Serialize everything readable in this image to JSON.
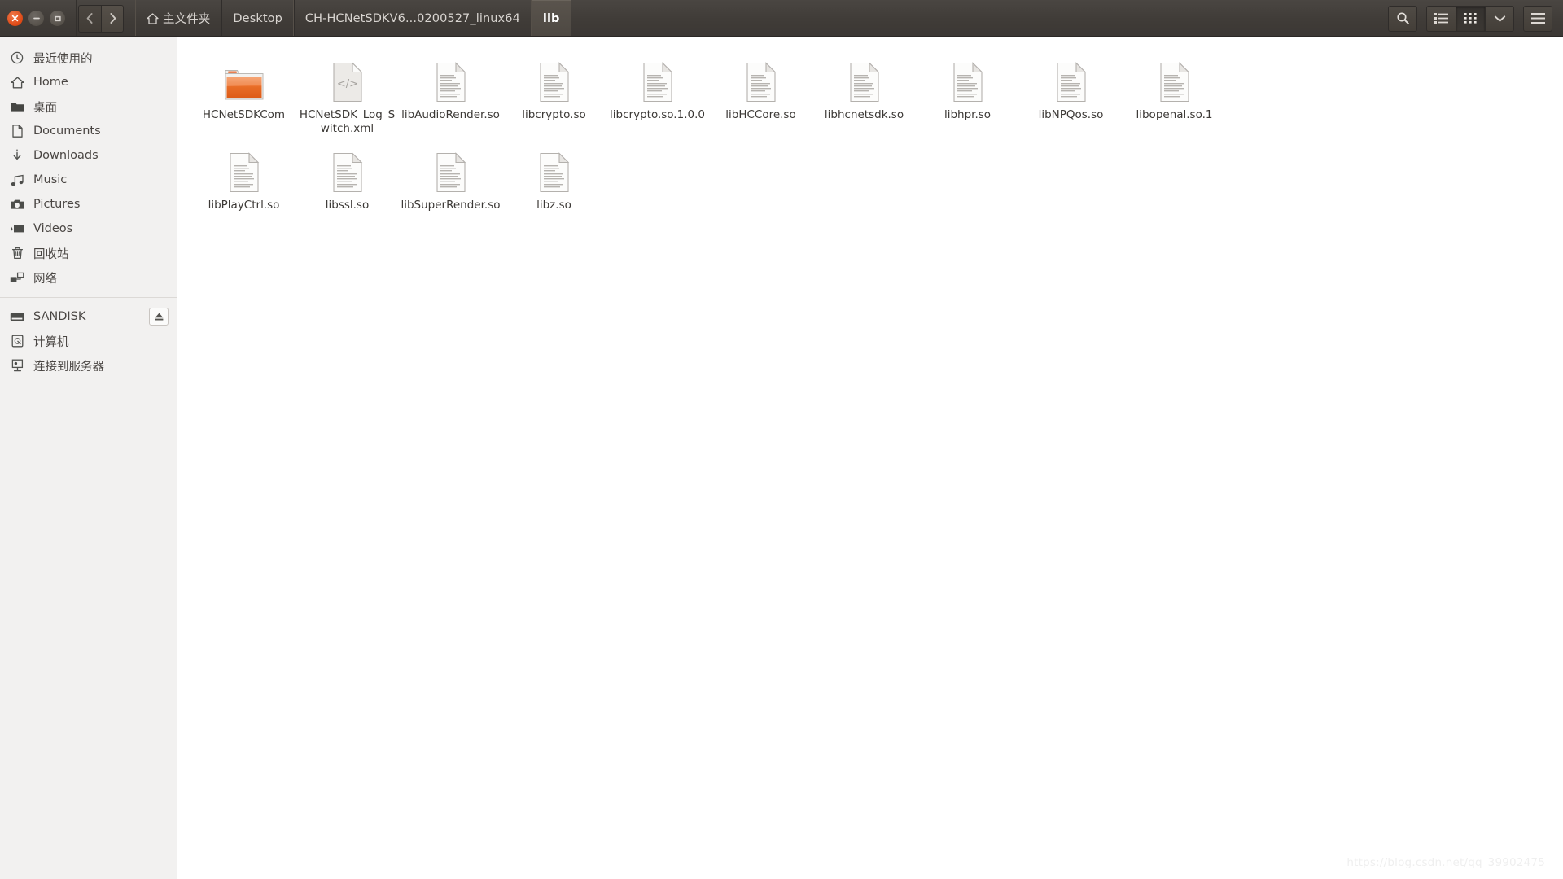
{
  "window": {
    "controls": [
      {
        "name": "close",
        "title": "Close",
        "color": "#dd4814"
      },
      {
        "name": "minimize",
        "title": "Minimize",
        "color": "#5a554f"
      },
      {
        "name": "maximize",
        "title": "Maximize",
        "color": "#5a554f"
      }
    ]
  },
  "nav": {
    "back_label": "Back",
    "forward_label": "Forward"
  },
  "breadcrumb": {
    "items": [
      {
        "label": "主文件夹",
        "icon": "home-icon",
        "active": false
      },
      {
        "label": "Desktop",
        "icon": "",
        "active": false
      },
      {
        "label": "CH-HCNetSDKV6...0200527_linux64",
        "icon": "",
        "active": false
      },
      {
        "label": "lib",
        "icon": "",
        "active": true
      }
    ]
  },
  "toolbar_buttons": [
    {
      "name": "search-icon",
      "label": "Search",
      "selected": false
    },
    {
      "name": "list-view-icon",
      "label": "List view",
      "selected": false
    },
    {
      "name": "grid-view-icon",
      "label": "Icon view",
      "selected": true
    },
    {
      "name": "chevron-down-icon",
      "label": "View options",
      "selected": false
    },
    {
      "name": "hamburger-menu-icon",
      "label": "Menu",
      "selected": false
    }
  ],
  "sidebar": {
    "items": [
      {
        "label": "最近使用的",
        "icon": "clock-icon"
      },
      {
        "label": "Home",
        "icon": "home-icon"
      },
      {
        "label": "桌面",
        "icon": "folder-icon"
      },
      {
        "label": "Documents",
        "icon": "document-icon"
      },
      {
        "label": "Downloads",
        "icon": "download-icon"
      },
      {
        "label": "Music",
        "icon": "music-icon"
      },
      {
        "label": "Pictures",
        "icon": "camera-icon"
      },
      {
        "label": "Videos",
        "icon": "video-icon"
      },
      {
        "label": "回收站",
        "icon": "trash-icon"
      },
      {
        "label": "网络",
        "icon": "network-icon"
      }
    ],
    "devices": [
      {
        "label": "SANDISK",
        "icon": "drive-icon",
        "eject": true,
        "eject_label": "Eject"
      },
      {
        "label": "计算机",
        "icon": "computer-icon",
        "eject": false
      },
      {
        "label": "连接到服务器",
        "icon": "connect-server-icon",
        "eject": false
      }
    ]
  },
  "files": {
    "row1": [
      {
        "name": "HCNetSDKCom",
        "type": "folder"
      },
      {
        "name": "HCNetSDK_Log_Switch.xml",
        "type": "xml"
      },
      {
        "name": "libAudioRender.so",
        "type": "document"
      },
      {
        "name": "libcrypto.so",
        "type": "document"
      },
      {
        "name": "libcrypto.so.1.0.0",
        "type": "document"
      },
      {
        "name": "libHCCore.so",
        "type": "document"
      },
      {
        "name": "libhcnetsdk.so",
        "type": "document"
      },
      {
        "name": "libhpr.so",
        "type": "document"
      },
      {
        "name": "libNPQos.so",
        "type": "document"
      },
      {
        "name": "libopenal.so.1",
        "type": "document"
      }
    ],
    "row2": [
      {
        "name": "libPlayCtrl.so",
        "type": "document"
      },
      {
        "name": "libssl.so",
        "type": "document"
      },
      {
        "name": "libSuperRender.so",
        "type": "document"
      },
      {
        "name": "libz.so",
        "type": "document"
      }
    ]
  },
  "watermark": {
    "text": "https://blog.csdn.net/qq_39902475"
  },
  "colors": {
    "toolbar_bg": "#403c38",
    "sidebar_bg": "#f2f1f0",
    "content_bg": "#ffffff",
    "folder_accent": "#e8703a",
    "text_light": "#d8d4d0",
    "text_dark": "#3c3936"
  }
}
